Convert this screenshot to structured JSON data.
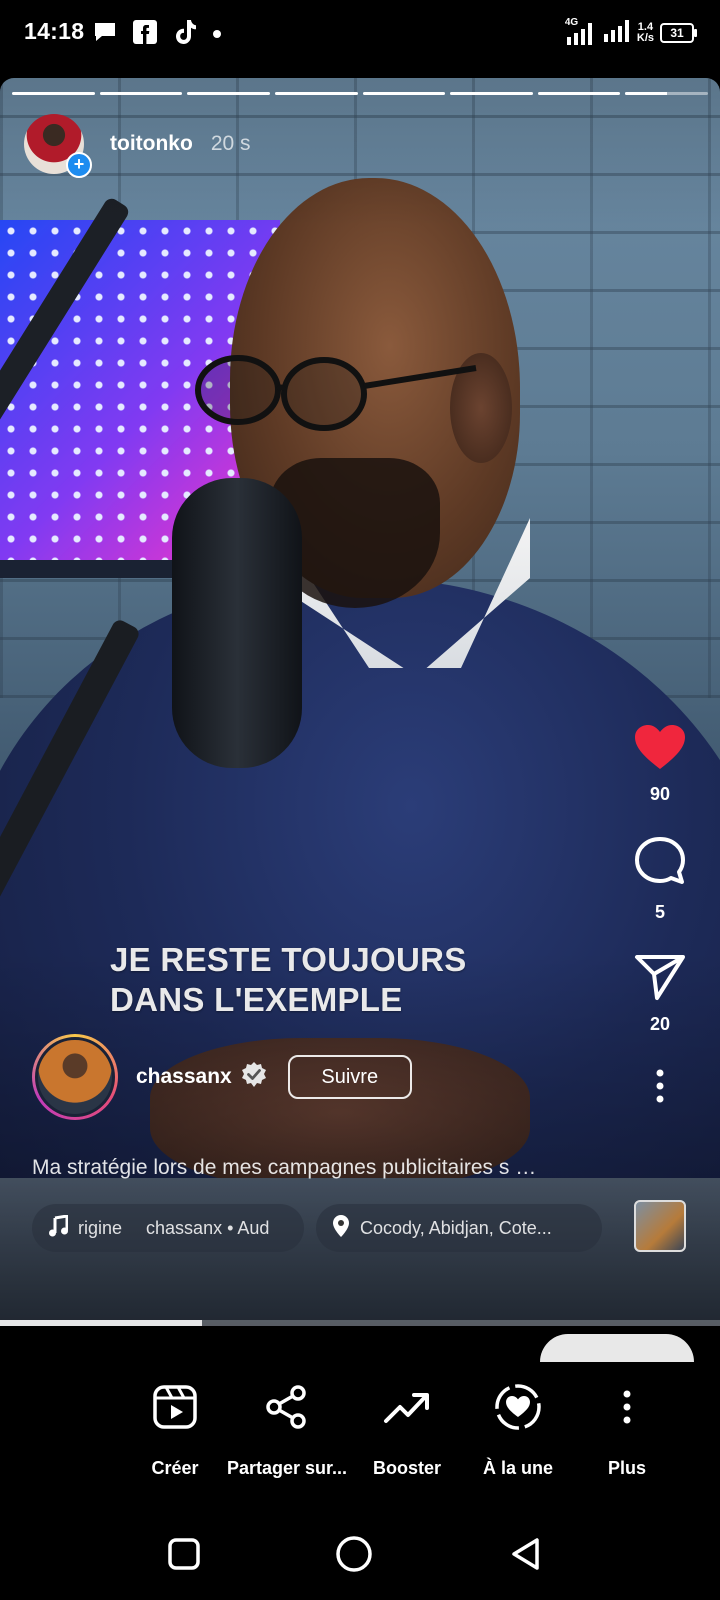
{
  "status_bar": {
    "time": "14:18",
    "network": "4G",
    "speed_value": "1.4",
    "speed_unit": "K/s",
    "battery": "31",
    "left_icons": [
      "message-bubble-icon",
      "facebook-icon",
      "tiktok-icon",
      "dot-icon"
    ]
  },
  "story": {
    "segments": 8,
    "active_segment": 8,
    "active_segment_progress": 0.5,
    "author_name": "toitonko",
    "time_ago": "20 s",
    "overlay_text_line1": "JE RESTE TOUJOURS",
    "overlay_text_line2": "DANS L'EXEMPLE",
    "video_progress": 0.28
  },
  "reel": {
    "poster_name": "chassanx",
    "follow_label": "Suivre",
    "description": "Ma stratégie lors de mes campagnes publicitaires s …",
    "audio_text_1": "rigine",
    "audio_text_2": "chassanx • Aud",
    "location": "Cocody, Abidjan, Cote..."
  },
  "rail": {
    "likes": "90",
    "comments": "5",
    "shares": "20"
  },
  "actions": [
    {
      "label": "Créer",
      "icon": "reel-play-icon"
    },
    {
      "label": "Partager sur...",
      "icon": "share-icon"
    },
    {
      "label": "Booster",
      "icon": "trend-up-icon"
    },
    {
      "label": "À la une",
      "icon": "highlight-heart-icon"
    },
    {
      "label": "Plus",
      "icon": "more-vertical-icon"
    }
  ],
  "colors": {
    "like": "#f0263d",
    "verified": "#e6e6e6",
    "background": "#000000"
  }
}
